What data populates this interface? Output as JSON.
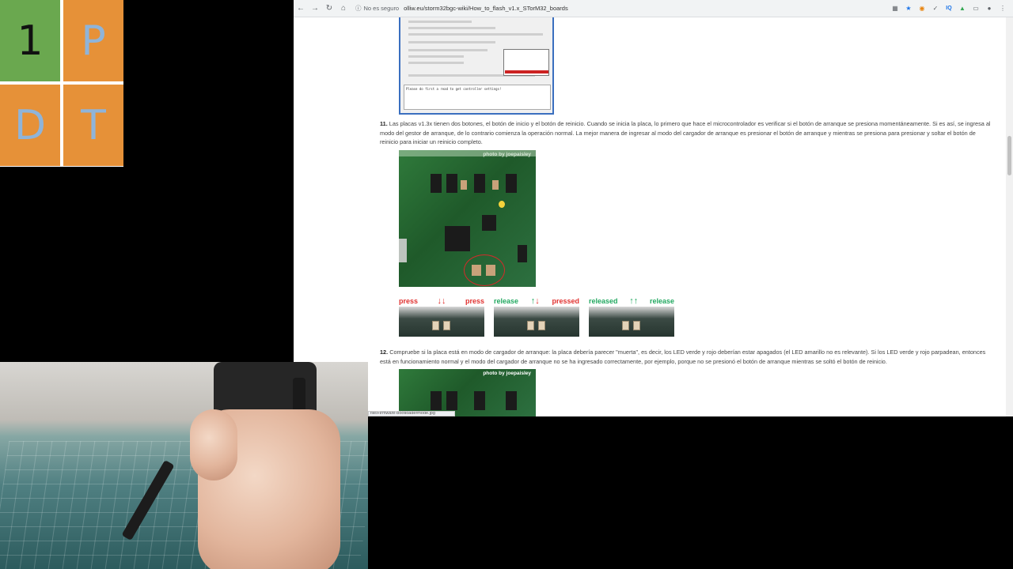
{
  "logo": {
    "tiles": [
      "1",
      "P",
      "D",
      "T"
    ]
  },
  "browser": {
    "security_label": "No es seguro",
    "url": "olliw.eu/storm32bgc-wiki/How_to_flash_v1.x_STorM32_boards",
    "dialog_log_text": "Please do first a read to get controller settings!",
    "paragraph_11": {
      "number": "11.",
      "text": "Las placas v1.3x tienen dos botones, el botón de inicio y el botón de reinicio. Cuando se inicia la placa, lo primero que hace el microcontrolador es verificar si el botón de arranque se presiona momentáneamente. Si es así, se ingresa al modo del gestor de arranque, de lo contrario comienza la operación normal. La mejor manera de ingresar al modo del cargador de arranque es presionar el botón de arranque y mientras se presiona para presionar y soltar el botón de reinicio para iniciar un reinicio completo."
    },
    "photo_credit": "photo by joepaisley",
    "steps": [
      {
        "left": "press",
        "right": "press"
      },
      {
        "left": "release",
        "right": "pressed"
      },
      {
        "left": "released",
        "right": "release"
      }
    ],
    "paragraph_12": {
      "number": "12.",
      "text": "Compruebe si la placa está en modo de cargador de arranque: la placa debería parecer \"muerta\", es decir, los LED verde y rojo deberían estar apagados (el LED amarillo no es relevante). Si los LED verde y rojo parpadean, entonces está en funcionamiento normal y el modo del cargador de arranque no se ha ingresado correctamente, por ejemplo, porque no se presionó el botón de arranque mientras se soltó el botón de reinicio."
    },
    "status_link": "file/Firmware-bootloadermode.jpg",
    "icons": [
      "back-icon",
      "forward-icon",
      "reload-icon",
      "home-icon",
      "info-icon",
      "translate-icon",
      "star-icon",
      "rss-icon",
      "extension-icon",
      "iq-icon",
      "shield-icon",
      "cast-icon",
      "profile-icon",
      "menu-icon"
    ],
    "colors": {
      "press_red": "#e0312f",
      "release_green": "#22a860",
      "dialog_border": "#3a6fbf"
    }
  }
}
